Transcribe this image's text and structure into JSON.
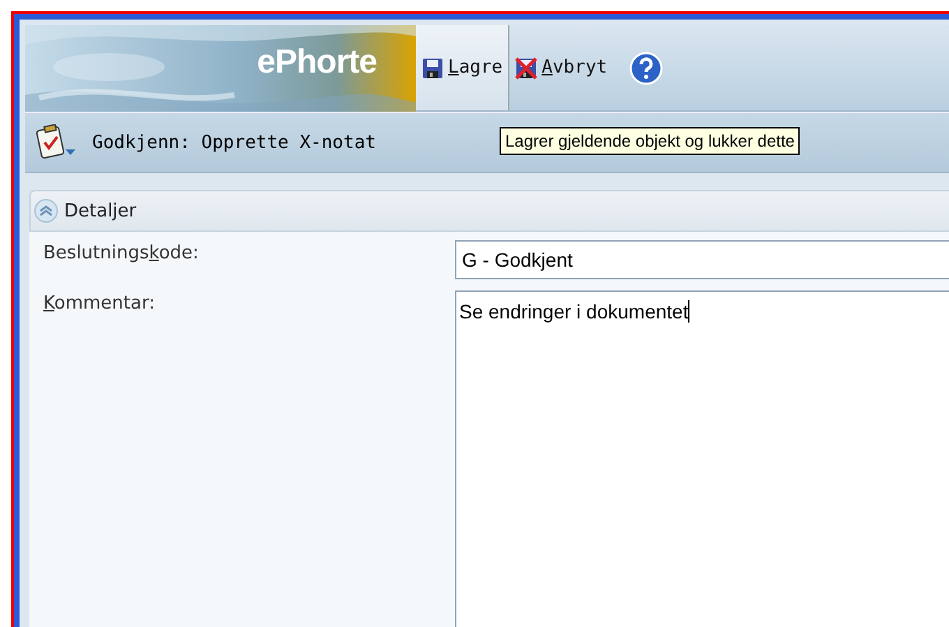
{
  "banner": {
    "logo": "ePhorte"
  },
  "toolbar": {
    "buttons": [
      {
        "kind": "save",
        "label": {
          "key": "L",
          "after": "agre"
        },
        "selected": true
      },
      {
        "kind": "cancel",
        "label": {
          "key": "A",
          "after": "vbryt"
        },
        "selected": false
      },
      {
        "kind": "help",
        "selected": false
      }
    ]
  },
  "task": {
    "title": "Godkjenn: Opprette X-notat"
  },
  "tooltip": "Lagrer gjeldende objekt og lukker dette",
  "section": {
    "title": "Detaljer",
    "expanded": true
  },
  "fields": [
    {
      "kind": "input",
      "label": {
        "before": "Beslutnings",
        "key": "k",
        "after": "ode:"
      },
      "value": "G - Godkjent"
    },
    {
      "kind": "textarea",
      "label": {
        "key": "K",
        "after": "ommentar:"
      },
      "value": "Se endringer i dokumentet"
    }
  ]
}
